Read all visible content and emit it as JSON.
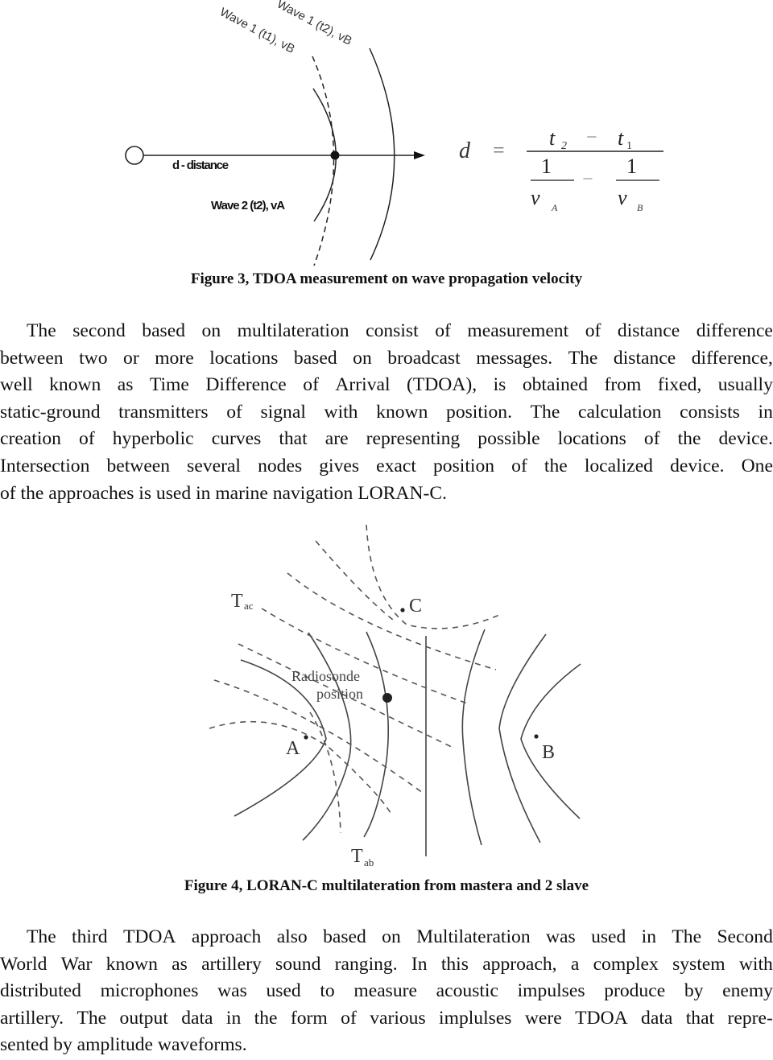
{
  "figure3": {
    "labels": {
      "wave1_t1": "Wave 1 (t1), vB",
      "wave1_t2": "Wave 1 (t2), vB",
      "distance": "d - distance",
      "wave2": "Wave 2 (t2), vA"
    },
    "formula": {
      "lhs": "d",
      "equals": "=",
      "t2": "t",
      "t2_sub": "2",
      "minus": "−",
      "t1": "t",
      "t1_sub": "1",
      "one_a": "1",
      "one_b": "1",
      "va": "v",
      "va_sub": "A",
      "vb": "v",
      "vb_sub": "B"
    },
    "caption": "Figure 3, TDOA measurement on wave propagation velocity"
  },
  "paragraph1": {
    "lines": [
      "The second based on multilateration consist of measurement of distance difference",
      "between two or more locations based on broadcast messages. The distance difference,",
      "well known as Time Difference of Arrival (TDOA), is obtained from fixed, usually",
      "static-ground transmitters of signal with known position. The calculation consists in",
      "creation of hyperbolic curves that are representing possible locations of the device.",
      "Intersection between several nodes gives exact position of the localized device. One",
      "of the approaches is used in marine navigation LORAN-C."
    ]
  },
  "figure4": {
    "labels": {
      "tac": "T",
      "tac_sub": "ac",
      "c": "C",
      "radiosonde_line1": "Radiosonde",
      "radiosonde_line2": "position",
      "a": "A",
      "b": "B",
      "tab": "T",
      "tab_sub": "ab"
    },
    "caption": "Figure 4, LORAN-C multilateration from mastera and 2 slave"
  },
  "paragraph2": {
    "lines": [
      "The third TDOA approach also based on Multilateration was used in The Second",
      "World War known as artillery sound ranging. In this approach, a complex system with",
      "distributed microphones was used to measure acoustic impulses produce by enemy",
      "artillery. The output data in the form of various implulses were TDOA data that repre-",
      "sented by amplitude waveforms."
    ]
  }
}
